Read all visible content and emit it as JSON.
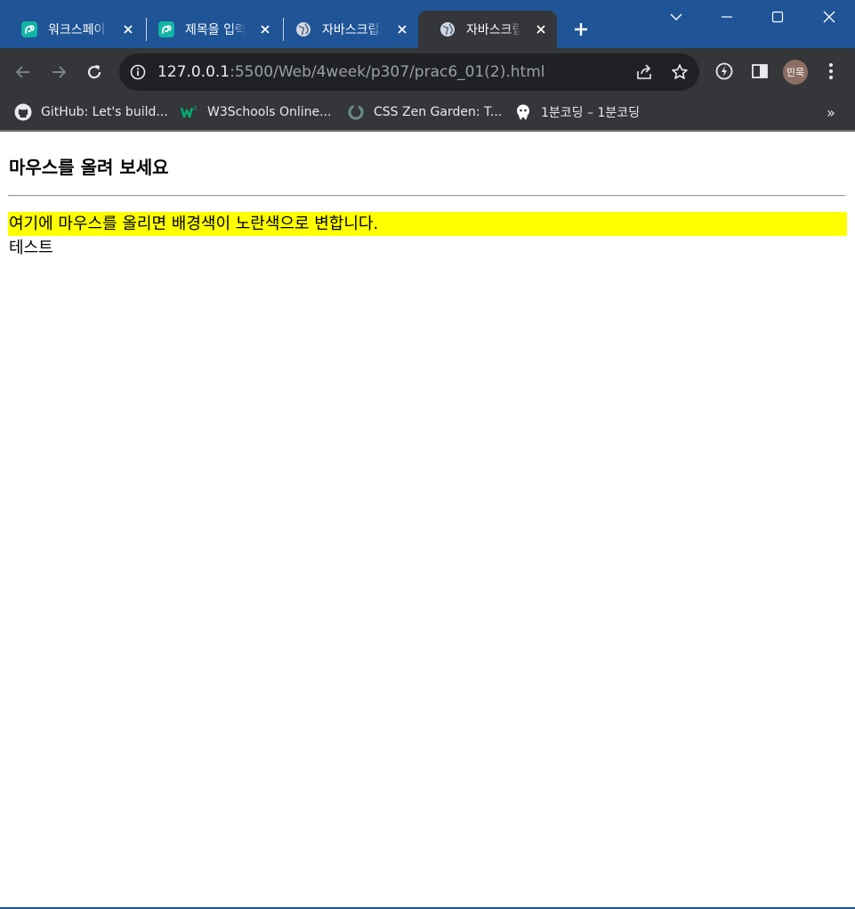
{
  "browser": {
    "tabs": [
      {
        "title": "워크스페이스",
        "favicon": "replit-icon",
        "active": false
      },
      {
        "title": "제목을 입력하세요",
        "favicon": "replit-icon",
        "active": false
      },
      {
        "title": "자바스크립트",
        "favicon": "globe-icon",
        "active": false
      },
      {
        "title": "자바스크립트",
        "favicon": "globe-icon",
        "active": true
      }
    ],
    "url_host": "127.0.0.1",
    "url_path": ":5500/Web/4week/p307/prac6_01(2).html",
    "profile_name": "민욱",
    "bookmarks": [
      {
        "label": "GitHub: Let's build...",
        "icon": "github-icon"
      },
      {
        "label": "W3Schools Online...",
        "icon": "w3schools-icon"
      },
      {
        "label": "CSS Zen Garden: T...",
        "icon": "zen-garden-icon"
      },
      {
        "label": "1분코딩 – 1분코딩",
        "icon": "onemin-coding-icon"
      }
    ],
    "bookmarks_overflow": "»",
    "colors": {
      "frame": "#1f5496",
      "toolbar": "#35363a",
      "omnibox": "#202124"
    }
  },
  "page": {
    "heading": "마우스를 올려 보세요",
    "hover_text": "여기에 마우스를 올리면 배경색이 노란색으로 변합니다.",
    "hover_bg": "#ffff00",
    "test_text": "테스트"
  }
}
